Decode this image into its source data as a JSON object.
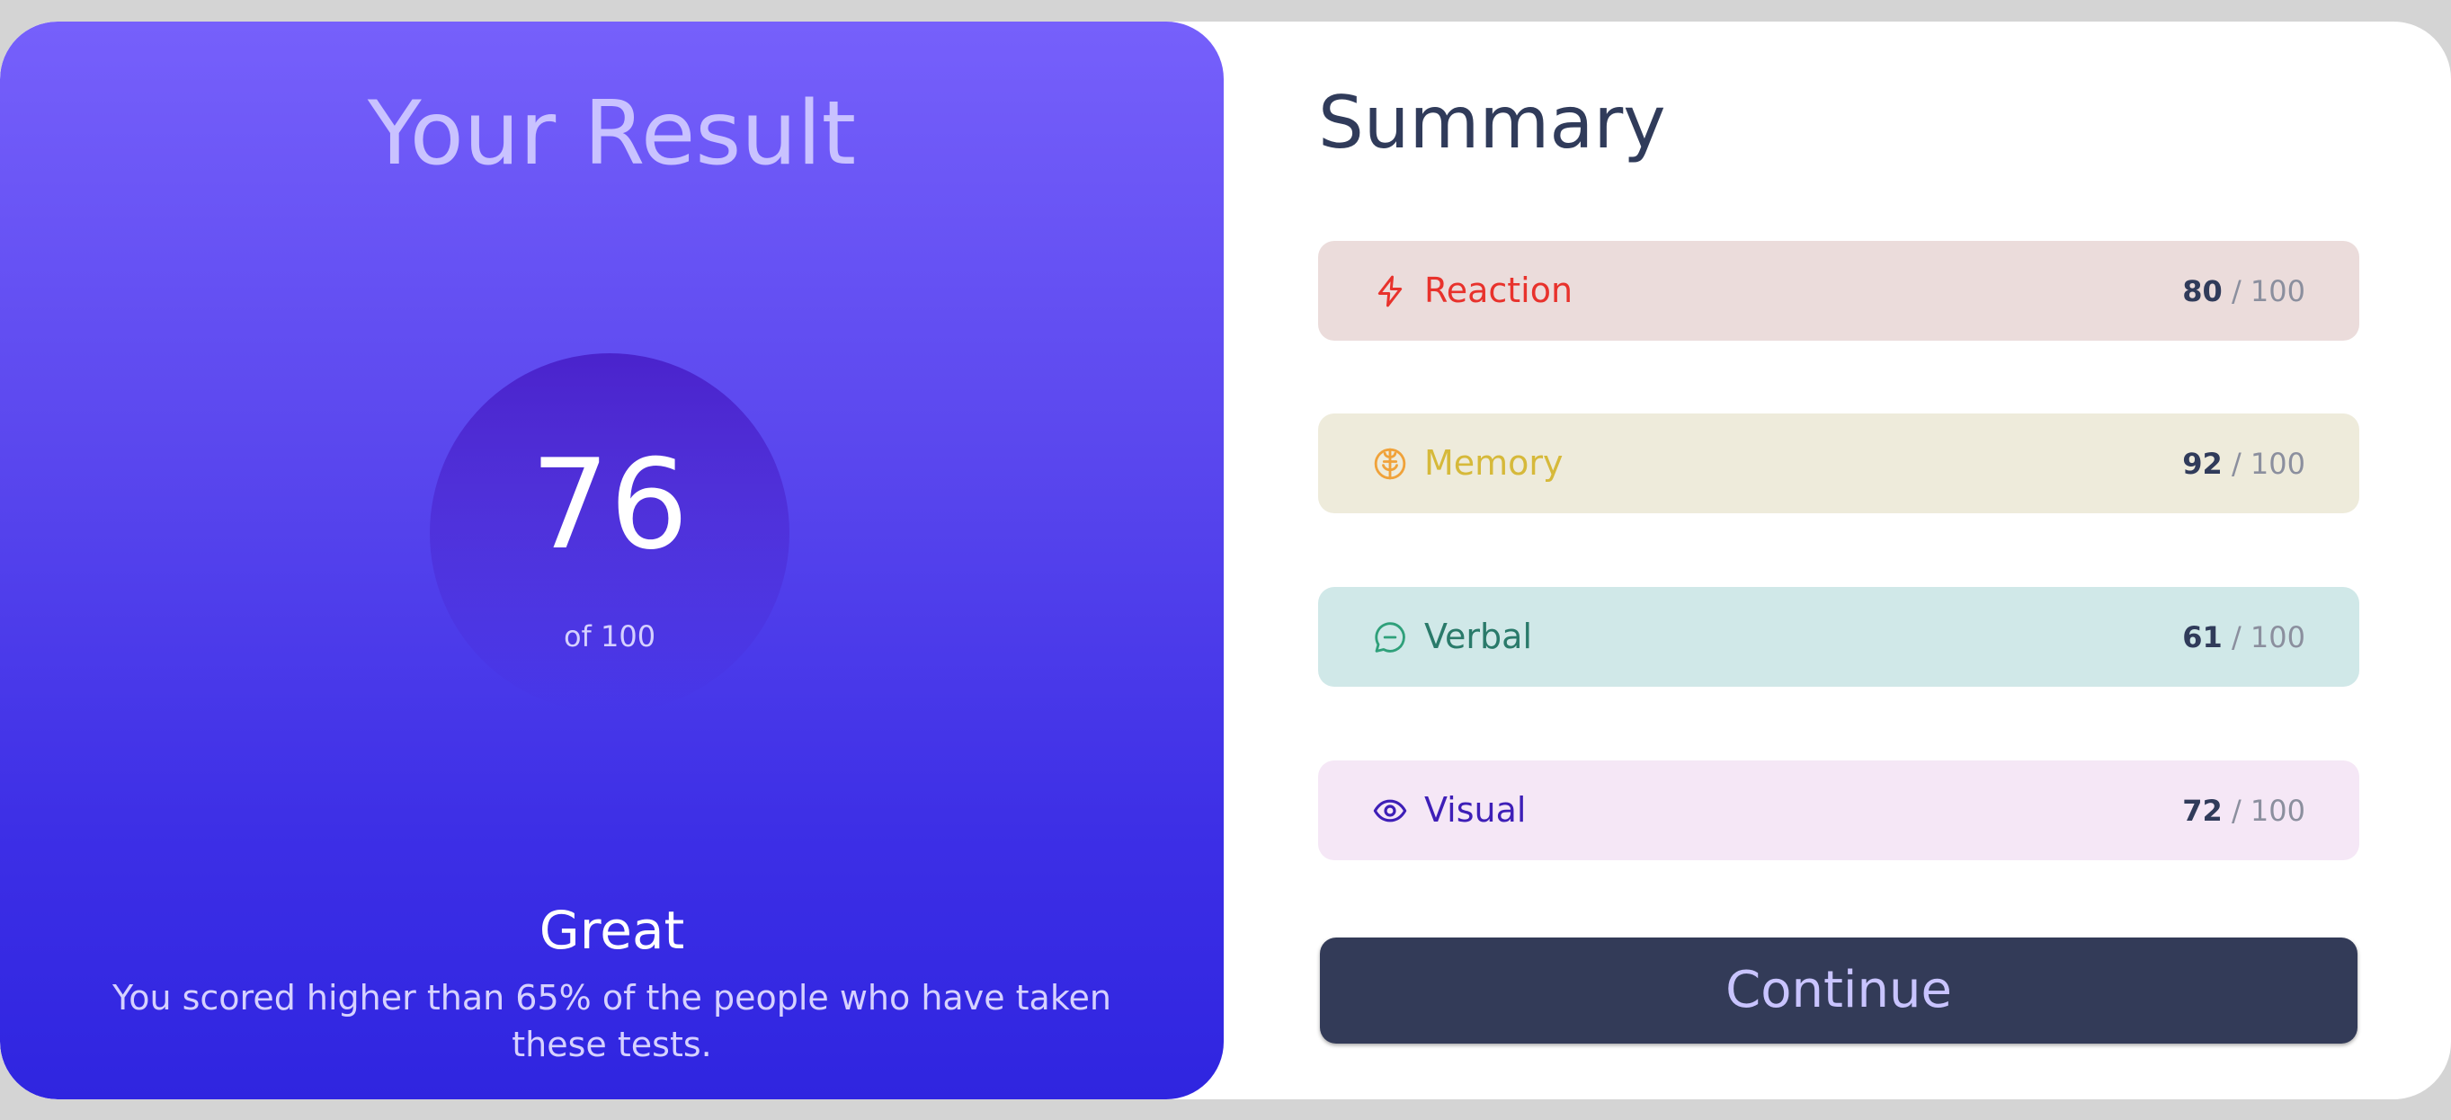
{
  "result": {
    "title": "Your Result",
    "score": "76",
    "score_of": "of 100",
    "verdict": "Great",
    "description": "You scored higher than 65% of the people who have taken these tests."
  },
  "summary": {
    "title": "Summary",
    "items": [
      {
        "label": "Reaction",
        "score": "80",
        "separator": "/",
        "max": "100",
        "icon": "lightning-icon",
        "color": "#e8322c",
        "bg": "#ebdcdb"
      },
      {
        "label": "Memory",
        "score": "92",
        "separator": "/",
        "max": "100",
        "icon": "brain-icon",
        "color": "#d6b93a",
        "bg": "#eeebdb"
      },
      {
        "label": "Verbal",
        "score": "61",
        "separator": "/",
        "max": "100",
        "icon": "chat-bubble-icon",
        "color": "#2a7a6a",
        "bg": "#d0e8e8"
      },
      {
        "label": "Visual",
        "score": "72",
        "separator": "/",
        "max": "100",
        "icon": "eye-icon",
        "color": "#3e1fb7",
        "bg": "#f5e7f6"
      }
    ],
    "continue_label": "Continue"
  }
}
